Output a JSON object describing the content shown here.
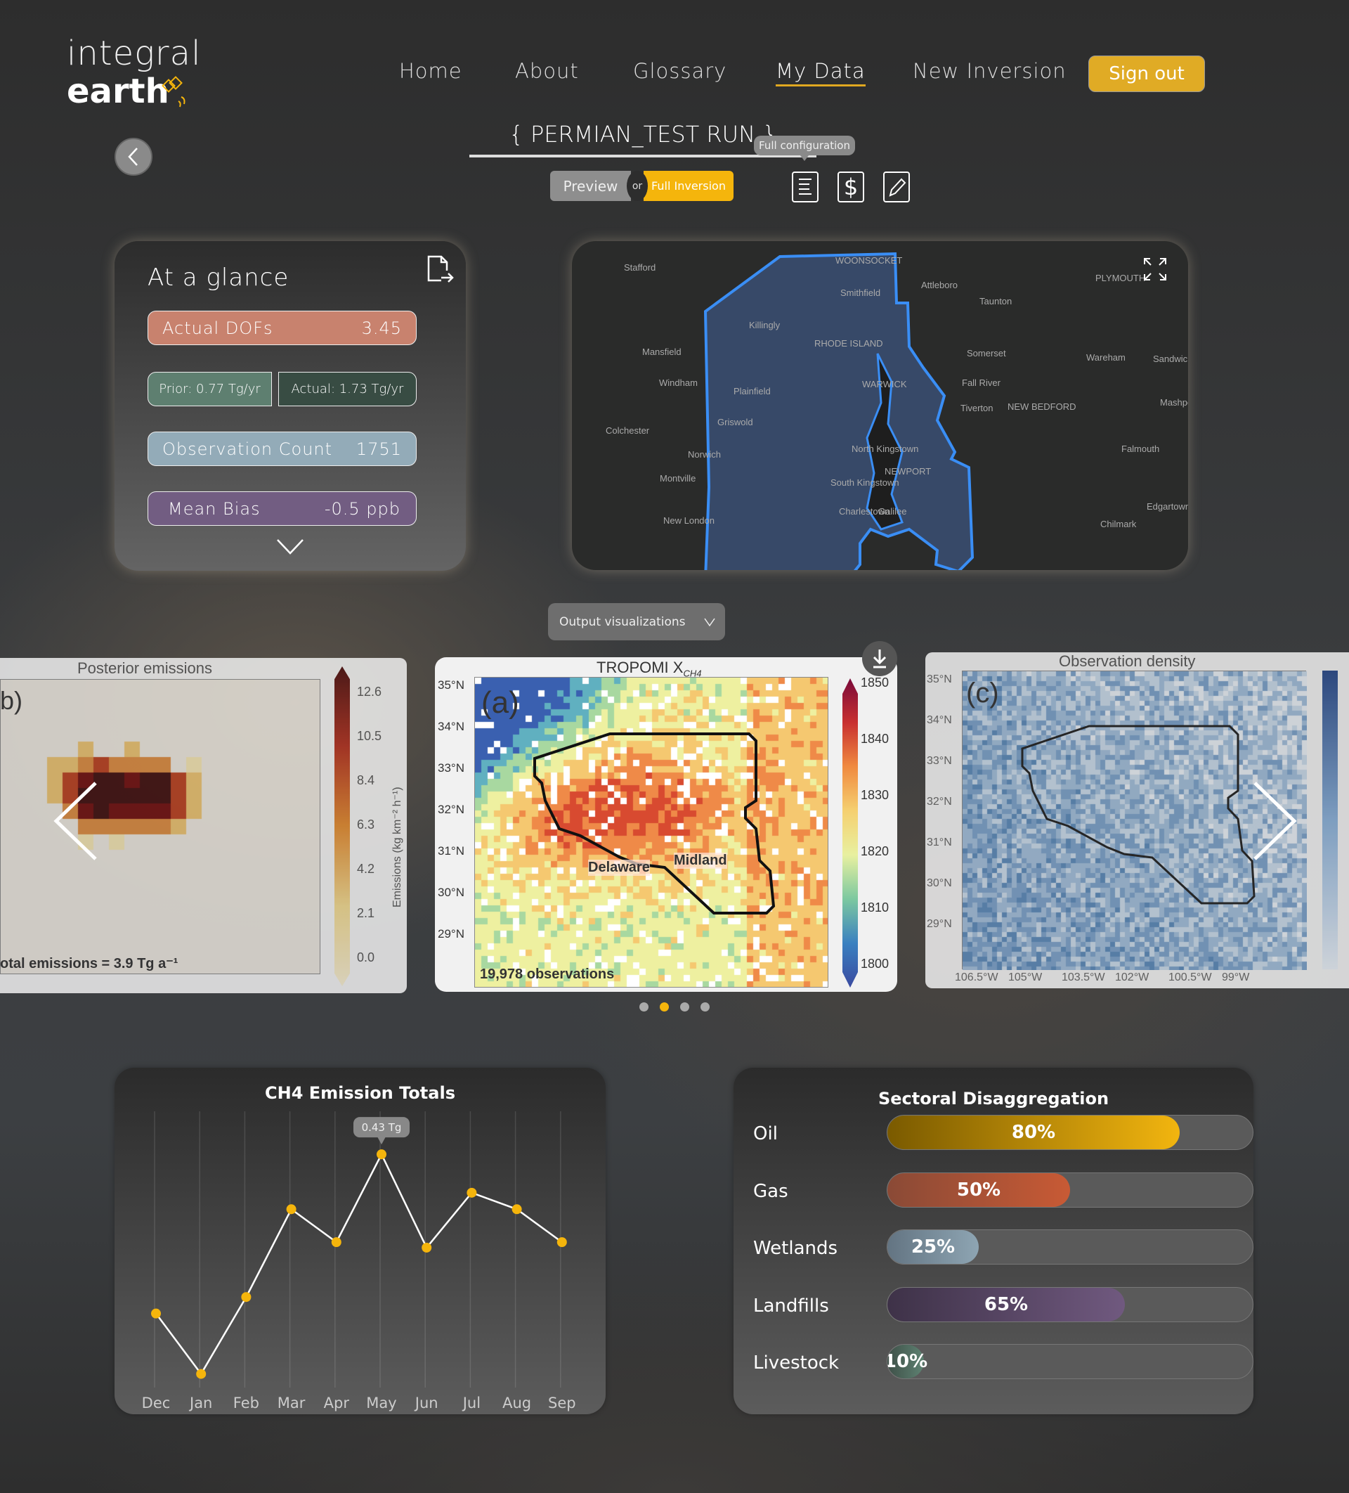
{
  "logo": {
    "line1": "integral",
    "line2": "earth"
  },
  "nav": {
    "items": [
      "Home",
      "About",
      "Glossary",
      "My Data",
      "New Inversion"
    ],
    "active": "My Data",
    "sign_out": "Sign out"
  },
  "run": {
    "title": "{ PERMIAN_TEST RUN }",
    "tooltip": "Full configuration",
    "toggle": {
      "preview": "Preview",
      "or": "or",
      "full": "Full Inversion",
      "selected": "Full Inversion"
    },
    "icons": [
      "document-lines-icon",
      "dollar-icon",
      "pencil-icon"
    ]
  },
  "glance": {
    "title": "At a glance",
    "dofs": {
      "label": "Actual DOFs",
      "value": "3.45"
    },
    "prior": "Prior: 0.77 Tg/yr",
    "actual": "Actual: 1.73 Tg/yr",
    "obs": {
      "label": "Observation Count",
      "value": "1751"
    },
    "bias": {
      "label": "Mean Bias",
      "value": "-0.5 ppb"
    },
    "colors": {
      "dofs": "#c8826e",
      "prior": "#5e7f70",
      "actual": "#384c43",
      "obs": "#93abb8",
      "bias": "#725d82"
    }
  },
  "map": {
    "labels": [
      "Stafford",
      "WOONSOCKET",
      "Smithfield",
      "Attleboro",
      "PLYMOUTH",
      "Taunton",
      "Killingly",
      "RHODE ISLAND",
      "Mansfield",
      "Somerset",
      "Wareham",
      "Sandwich",
      "Windham",
      "Plainfield",
      "WARWICK",
      "Fall River",
      "Tiverton",
      "NEW BEDFORD",
      "Mashpee",
      "Griswold",
      "Colchester",
      "North Kingstown",
      "Falmouth",
      "Norwich",
      "NEWPORT",
      "Montville",
      "South Kingstown",
      "Edgartown",
      "Charlestown",
      "Galilee",
      "New London",
      "Chilmark"
    ],
    "highlight_color": "#3a8ef5"
  },
  "viz": {
    "dropdown": "Output visualizations",
    "left": {
      "title": "Posterior emissions",
      "panel": "b)",
      "footer": "otal emissions = 3.9 Tg a⁻¹",
      "ticks": [
        "12.6",
        "10.5",
        "8.4",
        "6.3",
        "4.2",
        "2.1",
        "0.0"
      ],
      "cbar_label": "Emissions (kg km⁻² h⁻¹)"
    },
    "center": {
      "title": "TROPOMI X",
      "title_sub": "CH4",
      "panel": "(a)",
      "lat": [
        "35°N",
        "34°N",
        "33°N",
        "32°N",
        "31°N",
        "30°N",
        "29°N"
      ],
      "ticks": [
        "1850",
        "1840",
        "1830",
        "1820",
        "1810",
        "1800"
      ],
      "basin1": "Delaware",
      "basin2": "Midland",
      "footer": "19,978 observations"
    },
    "right": {
      "title": "Observation density",
      "panel": "(c)",
      "lat": [
        "35°N",
        "34°N",
        "33°N",
        "32°N",
        "31°N",
        "30°N",
        "29°N"
      ],
      "lon": [
        "106.5°W",
        "105°W",
        "103.5°W",
        "102°W",
        "100.5°W",
        "99°W"
      ]
    },
    "dots": 4,
    "active_dot": 2
  },
  "chart_data": {
    "type": "line",
    "title": "CH4 Emission Totals",
    "categories": [
      "Dec",
      "Jan",
      "Feb",
      "Mar",
      "Apr",
      "May",
      "Jun",
      "Jul",
      "Aug",
      "Sep"
    ],
    "values": [
      0.14,
      0.03,
      0.17,
      0.33,
      0.27,
      0.43,
      0.26,
      0.36,
      0.33,
      0.27
    ],
    "unit": "Tg",
    "tooltip": {
      "category": "May",
      "label": "0.43 Tg"
    },
    "grid": "vertical",
    "point_color": "#f5b50c"
  },
  "sectoral": {
    "title": "Sectoral Disaggregation",
    "items": [
      {
        "label": "Oil",
        "value": 80,
        "text": "80%",
        "from": "#7a5a00",
        "to": "#f2b50f"
      },
      {
        "label": "Gas",
        "value": 50,
        "text": "50%",
        "from": "#8a4a36",
        "to": "#c85a35"
      },
      {
        "label": "Wetlands",
        "value": 25,
        "text": "25%",
        "from": "#637482",
        "to": "#8ea5b3"
      },
      {
        "label": "Landfills",
        "value": 65,
        "text": "65%",
        "from": "#3e3248",
        "to": "#70597f"
      },
      {
        "label": "Livestock",
        "value": 10,
        "text": "10%",
        "from": "#3e5048",
        "to": "#5e8272"
      }
    ]
  }
}
